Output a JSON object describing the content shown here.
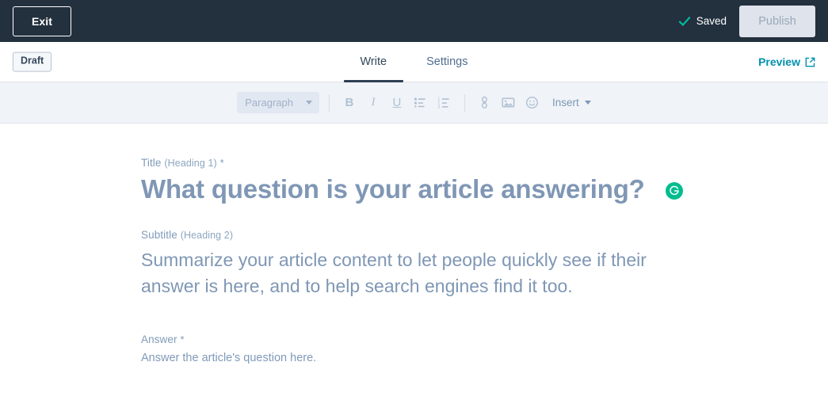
{
  "topbar": {
    "exit_label": "Exit",
    "save_status": "Saved",
    "save_icon": "check-icon",
    "publish_label": "Publish",
    "background_color": "#23303e",
    "check_color": "#00bda5"
  },
  "tabbar": {
    "status_badge": "Draft",
    "tabs": [
      {
        "label": "Write",
        "active": true
      },
      {
        "label": "Settings",
        "active": false
      }
    ],
    "preview_label": "Preview",
    "preview_icon": "external-link-icon",
    "preview_color": "#0091ae"
  },
  "toolbar": {
    "style_select": {
      "value": "Paragraph",
      "icon": "chevron-down-icon"
    },
    "format_buttons": [
      {
        "name": "bold-button",
        "glyph": "B"
      },
      {
        "name": "italic-button",
        "glyph": "I"
      },
      {
        "name": "underline-button",
        "glyph": "U"
      },
      {
        "name": "bulleted-list-button",
        "glyph": "bulleted-list-icon"
      },
      {
        "name": "numbered-list-button",
        "glyph": "numbered-list-icon"
      }
    ],
    "insert_buttons": [
      {
        "name": "link-button",
        "glyph": "link-icon"
      },
      {
        "name": "image-button",
        "glyph": "image-icon"
      },
      {
        "name": "emoji-button",
        "glyph": "emoji-icon"
      }
    ],
    "insert_menu_label": "Insert",
    "insert_menu_icon": "chevron-down-icon"
  },
  "document": {
    "title_label": "Title",
    "title_label_hint": "(Heading 1)",
    "title_required_mark": "*",
    "title_text": "What question is your article answering?",
    "title_action_icon": "regenerate-icon",
    "subtitle_label": "Subtitle",
    "subtitle_label_hint": "(Heading 2)",
    "subtitle_text": "Summarize your article content to let people quickly see if their answer is here, and to help search engines find it too.",
    "answer_label": "Answer",
    "answer_required_mark": "*",
    "answer_placeholder": "Answer the article's question here."
  }
}
